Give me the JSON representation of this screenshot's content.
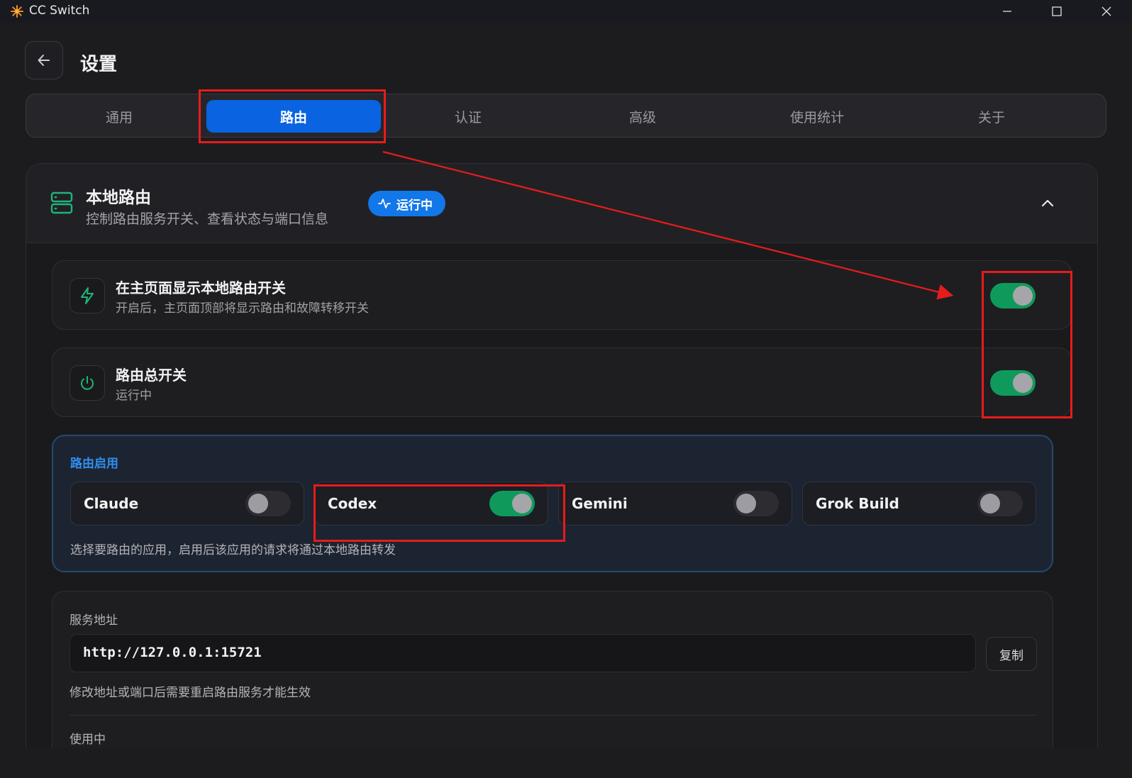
{
  "window": {
    "title": "CC Switch"
  },
  "header": {
    "title": "设置"
  },
  "tabs": [
    {
      "label": "通用",
      "active": false
    },
    {
      "label": "路由",
      "active": true
    },
    {
      "label": "认证",
      "active": false
    },
    {
      "label": "高级",
      "active": false
    },
    {
      "label": "使用统计",
      "active": false
    },
    {
      "label": "关于",
      "active": false
    }
  ],
  "local_routing": {
    "title": "本地路由",
    "description": "控制路由服务开关、查看状态与端口信息",
    "status": "运行中",
    "settings": [
      {
        "title": "在主页面显示本地路由开关",
        "subtitle": "开启后，主页面顶部将显示路由和故障转移开关",
        "icon": "lightning-icon",
        "enabled": true
      },
      {
        "title": "路由总开关",
        "subtitle": "运行中",
        "icon": "power-icon",
        "enabled": true
      }
    ],
    "routing_enable": {
      "label": "路由启用",
      "apps": [
        {
          "name": "Claude",
          "enabled": false
        },
        {
          "name": "Codex",
          "enabled": true
        },
        {
          "name": "Gemini",
          "enabled": false
        },
        {
          "name": "Grok Build",
          "enabled": false
        }
      ],
      "note": "选择要路由的应用，启用后该应用的请求将通过本地路由转发"
    },
    "service": {
      "label": "服务地址",
      "address": "http://127.0.0.1:15721",
      "copy_label": "复制",
      "note": "修改地址或端口后需要重启路由服务才能生效",
      "in_use_label": "使用中"
    }
  },
  "colors": {
    "accent": "#0a63e0",
    "status_pill": "#1277e8",
    "toggle_on": "#0f9a5c",
    "annotation": "#e81b1b",
    "panel_label": "#2f8ff0"
  }
}
